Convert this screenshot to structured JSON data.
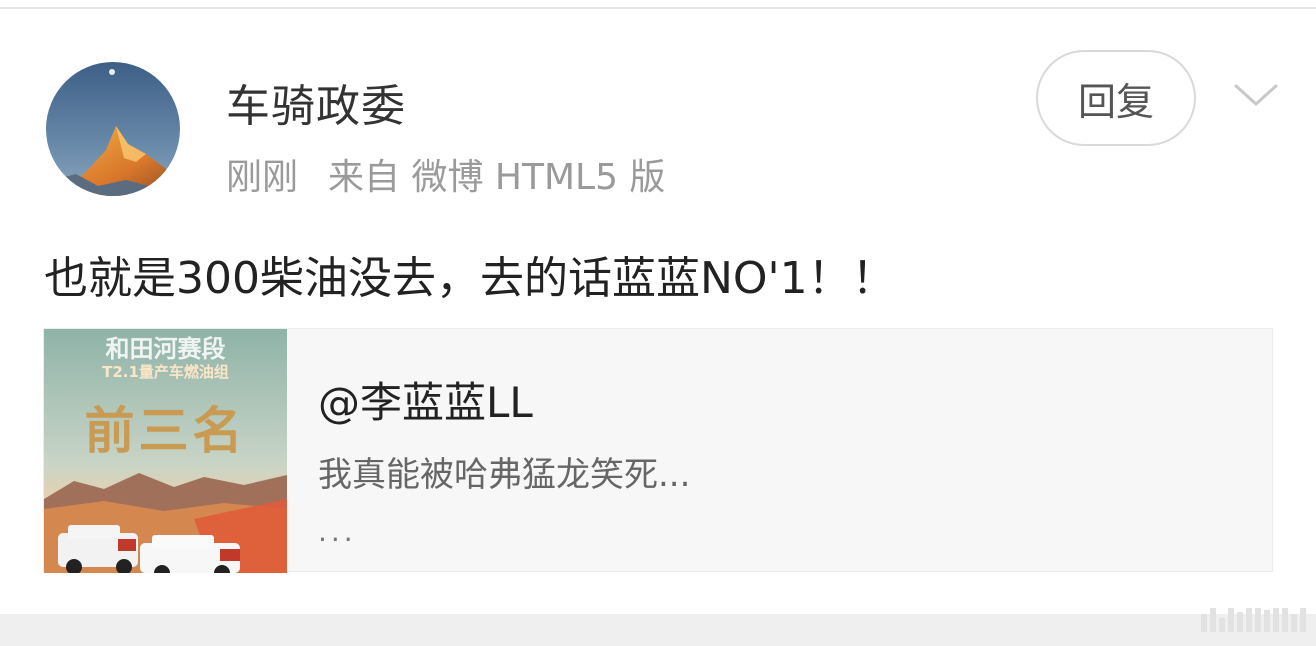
{
  "post": {
    "username": "车骑政委",
    "time": "刚刚",
    "source": "来自 微博 HTML5 版",
    "reply_label": "回复",
    "text": "也就是300柴油没去，去的话蓝蓝NO'1！！",
    "avatar_icon": "mountain-sunset-avatar",
    "menu_icon": "chevron-down-icon"
  },
  "quoted_card": {
    "author": "@李蓝蓝LL",
    "excerpt": "我真能被哈弗猛龙笑死...",
    "more": "...",
    "thumbnail": {
      "line1": "和田河赛段",
      "line2": "T2.1量产车燃油组",
      "line3": "前三名"
    }
  },
  "colors": {
    "text_primary": "#222222",
    "text_secondary": "#9a9a9a",
    "card_bg": "#f7f7f7",
    "button_border": "#d9d9d9"
  }
}
